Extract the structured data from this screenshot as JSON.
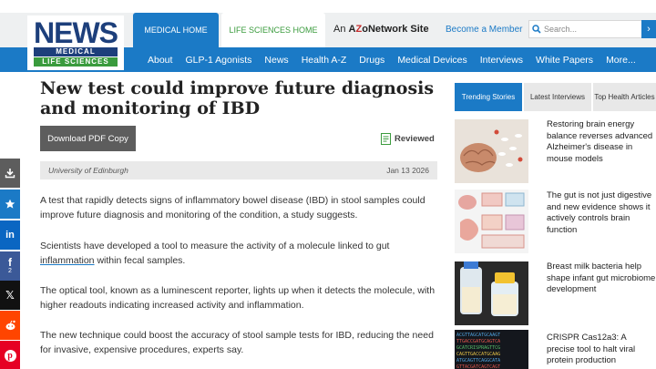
{
  "brand": {
    "logo_word": "NEWS",
    "logo_line1": "MEDICAL",
    "logo_line2": "LIFE SCIENCES"
  },
  "header": {
    "tab_medical": "MEDICAL HOME",
    "tab_life": "LIFE SCIENCES HOME",
    "azo_prefix": "An",
    "azo_a": "A",
    "azo_z": "Z",
    "azo_rest": "oNetwork Site",
    "become_member": "Become a Member",
    "search_placeholder": "Search...",
    "search_go": "›"
  },
  "nav": {
    "items": [
      "About",
      "GLP-1 Agonists",
      "News",
      "Health A-Z",
      "Drugs",
      "Medical Devices",
      "Interviews",
      "White Papers",
      "More..."
    ]
  },
  "article": {
    "title": "New test could improve future diagnosis and monitoring of IBD",
    "pdf_button": "Download PDF Copy",
    "reviewed": "Reviewed",
    "source": "University of Edinburgh",
    "date": "Jan 13 2026",
    "p1": "A test that rapidly detects signs of inflammatory bowel disease (IBD) in stool samples could improve future diagnosis and monitoring of the condition, a study suggests.",
    "p2_before": "Scientists have developed a tool to measure the activity of a molecule linked to gut ",
    "p2_link": "inflammation",
    "p2_after": " within fecal samples.",
    "p3": "The optical tool, known as a luminescent reporter, lights up when it detects the molecule, with higher readouts indicating increased activity and inflammation.",
    "p4": "The new technique could boost the accuracy of stool sample tests for IBD, reducing the need for invasive, expensive procedures, experts say."
  },
  "share": {
    "facebook_count": "2",
    "icons": [
      "download-icon",
      "star-icon",
      "linkedin-icon",
      "facebook-icon",
      "x-icon",
      "reddit-icon",
      "pinterest-icon"
    ]
  },
  "sidebar": {
    "tabs": [
      "Trending Stories",
      "Latest Interviews",
      "Top Health Articles"
    ],
    "stories": [
      "Restoring brain energy balance reverses advanced Alzheimer's disease in mouse models",
      "The gut is not just digestive and new evidence shows it actively controls brain function",
      "Breast milk bacteria help shape infant gut microbiome development",
      "CRISPR Cas12a3: A precise tool to halt viral protein production"
    ]
  },
  "colors": {
    "brand_blue": "#1b7ac6",
    "brand_navy": "#1d3f7b",
    "brand_green": "#3a9b3d",
    "facebook": "#3b5998",
    "linkedin": "#0a66c2",
    "reddit": "#ff4500",
    "pinterest": "#e60023"
  }
}
